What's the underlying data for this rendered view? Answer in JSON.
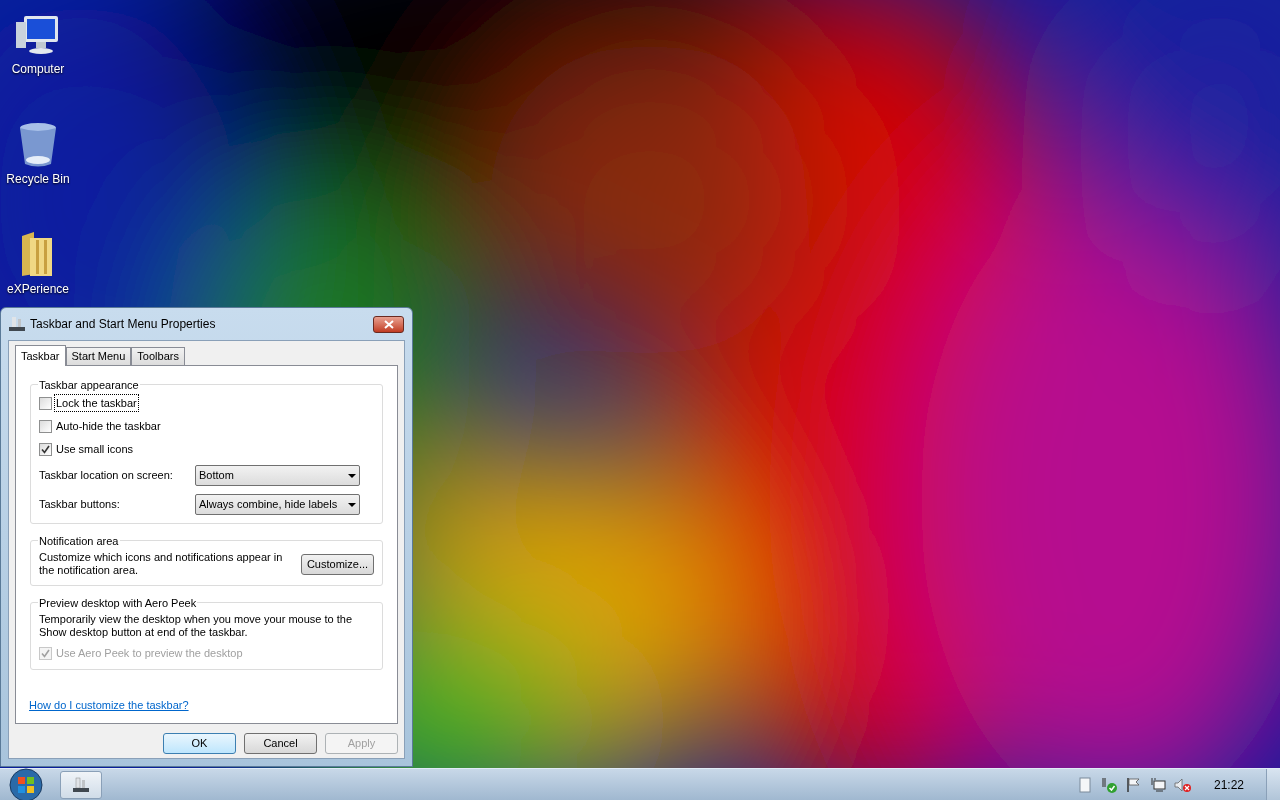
{
  "desktop_icons": [
    {
      "label": "Computer",
      "kind": "computer"
    },
    {
      "label": "Recycle Bin",
      "kind": "bin"
    },
    {
      "label": "eXPerience",
      "kind": "folder"
    }
  ],
  "dialog": {
    "title": "Taskbar and Start Menu Properties",
    "tabs": [
      {
        "label": "Taskbar",
        "selected": true
      },
      {
        "label": "Start Menu",
        "selected": false
      },
      {
        "label": "Toolbars",
        "selected": false
      }
    ],
    "appearance": {
      "heading": "Taskbar appearance",
      "checkboxes": [
        {
          "label": "Lock the taskbar",
          "checked": false,
          "focused": true
        },
        {
          "label": "Auto-hide the taskbar",
          "checked": false,
          "focused": false
        },
        {
          "label": "Use small icons",
          "checked": true,
          "focused": false
        }
      ],
      "dropdowns": [
        {
          "label": "Taskbar location on screen:",
          "value": "Bottom"
        },
        {
          "label": "Taskbar buttons:",
          "value": "Always combine, hide labels"
        }
      ]
    },
    "notification": {
      "heading": "Notification area",
      "text": "Customize which icons and notifications appear in the notification area.",
      "button": "Customize..."
    },
    "peek": {
      "heading": "Preview desktop with Aero Peek",
      "text": "Temporarily view the desktop when you move your mouse to the Show desktop button at end of the taskbar.",
      "checkbox": {
        "label": "Use Aero Peek to preview the desktop",
        "checked": true,
        "disabled": true
      }
    },
    "help_link": "How do I customize the taskbar?",
    "buttons": [
      {
        "label": "OK",
        "default": true,
        "disabled": false
      },
      {
        "label": "Cancel",
        "default": false,
        "disabled": false
      },
      {
        "label": "Apply",
        "default": false,
        "disabled": true
      }
    ]
  },
  "taskbar": {
    "clock": "21:22"
  }
}
